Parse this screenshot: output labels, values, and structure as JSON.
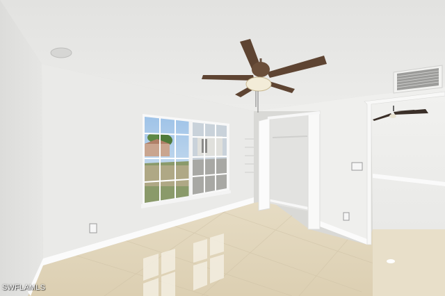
{
  "watermark": {
    "text": "SWFLAMLS"
  },
  "colors": {
    "ceiling": "#e8e8e6",
    "left_wall": "#e3e3e1",
    "back_wall": "#ecebea",
    "right_wall": "#f0f0ee",
    "floor": "#e6dcc6",
    "fan_blade": "#5e4432",
    "baseboard": "#fafafa"
  }
}
